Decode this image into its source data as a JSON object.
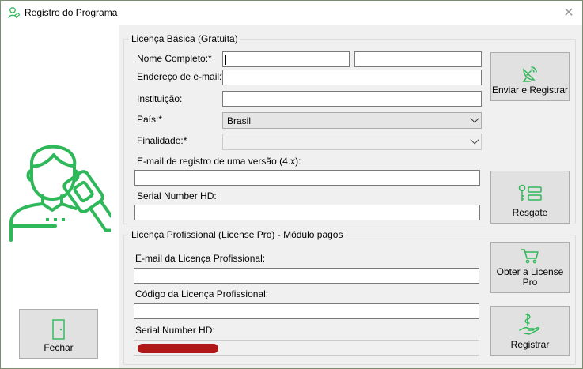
{
  "window": {
    "title": "Registro do Programa"
  },
  "left": {
    "close_button": "Fechar"
  },
  "basic": {
    "group_title": "Licença Básica (Gratuita)",
    "full_name_label": "Nome Completo:*",
    "email_label": "Endereço de e-mail:*",
    "institution_label": "Instituição:",
    "country_label": "País:*",
    "country_value": "Brasil",
    "purpose_label": "Finalidade:*",
    "purpose_value": "",
    "legacy_email_label": "E-mail de registro de uma versão (4.x):",
    "serial_label": "Serial Number HD:",
    "send_button": "Enviar e Registrar",
    "redeem_button": "Resgate"
  },
  "pro": {
    "group_title": "Licença Profissional (License Pro) - Módulo pagos",
    "email_label": "E-mail da Licença Profissional:",
    "code_label": "Código da Licença Profissional:",
    "serial_label": "Serial Number HD:",
    "get_button": "Obter a License Pro",
    "register_button": "Registrar"
  },
  "colors": {
    "accent_green": "#2fb85a",
    "button_bg": "#e1e1e1",
    "panel_bg": "#f0f0f0"
  },
  "icons": [
    "user-key-icon",
    "door-icon",
    "satellite-dish-icon",
    "key-list-icon",
    "cart-icon",
    "hand-money-icon",
    "close-icon"
  ]
}
